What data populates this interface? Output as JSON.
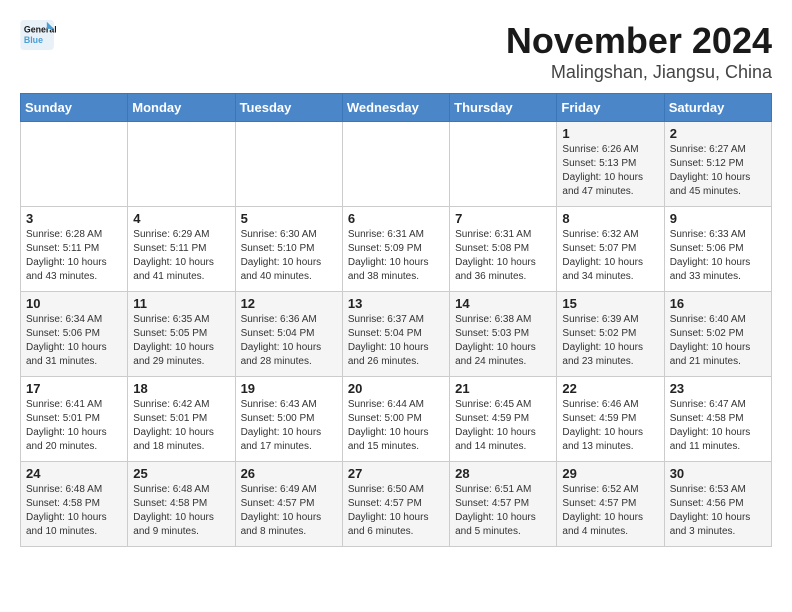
{
  "logo": {
    "text_general": "General",
    "text_blue": "Blue"
  },
  "title": "November 2024",
  "subtitle": "Malingshan, Jiangsu, China",
  "days_of_week": [
    "Sunday",
    "Monday",
    "Tuesday",
    "Wednesday",
    "Thursday",
    "Friday",
    "Saturday"
  ],
  "weeks": [
    [
      {
        "day": "",
        "info": ""
      },
      {
        "day": "",
        "info": ""
      },
      {
        "day": "",
        "info": ""
      },
      {
        "day": "",
        "info": ""
      },
      {
        "day": "",
        "info": ""
      },
      {
        "day": "1",
        "info": "Sunrise: 6:26 AM\nSunset: 5:13 PM\nDaylight: 10 hours\nand 47 minutes."
      },
      {
        "day": "2",
        "info": "Sunrise: 6:27 AM\nSunset: 5:12 PM\nDaylight: 10 hours\nand 45 minutes."
      }
    ],
    [
      {
        "day": "3",
        "info": "Sunrise: 6:28 AM\nSunset: 5:11 PM\nDaylight: 10 hours\nand 43 minutes."
      },
      {
        "day": "4",
        "info": "Sunrise: 6:29 AM\nSunset: 5:11 PM\nDaylight: 10 hours\nand 41 minutes."
      },
      {
        "day": "5",
        "info": "Sunrise: 6:30 AM\nSunset: 5:10 PM\nDaylight: 10 hours\nand 40 minutes."
      },
      {
        "day": "6",
        "info": "Sunrise: 6:31 AM\nSunset: 5:09 PM\nDaylight: 10 hours\nand 38 minutes."
      },
      {
        "day": "7",
        "info": "Sunrise: 6:31 AM\nSunset: 5:08 PM\nDaylight: 10 hours\nand 36 minutes."
      },
      {
        "day": "8",
        "info": "Sunrise: 6:32 AM\nSunset: 5:07 PM\nDaylight: 10 hours\nand 34 minutes."
      },
      {
        "day": "9",
        "info": "Sunrise: 6:33 AM\nSunset: 5:06 PM\nDaylight: 10 hours\nand 33 minutes."
      }
    ],
    [
      {
        "day": "10",
        "info": "Sunrise: 6:34 AM\nSunset: 5:06 PM\nDaylight: 10 hours\nand 31 minutes."
      },
      {
        "day": "11",
        "info": "Sunrise: 6:35 AM\nSunset: 5:05 PM\nDaylight: 10 hours\nand 29 minutes."
      },
      {
        "day": "12",
        "info": "Sunrise: 6:36 AM\nSunset: 5:04 PM\nDaylight: 10 hours\nand 28 minutes."
      },
      {
        "day": "13",
        "info": "Sunrise: 6:37 AM\nSunset: 5:04 PM\nDaylight: 10 hours\nand 26 minutes."
      },
      {
        "day": "14",
        "info": "Sunrise: 6:38 AM\nSunset: 5:03 PM\nDaylight: 10 hours\nand 24 minutes."
      },
      {
        "day": "15",
        "info": "Sunrise: 6:39 AM\nSunset: 5:02 PM\nDaylight: 10 hours\nand 23 minutes."
      },
      {
        "day": "16",
        "info": "Sunrise: 6:40 AM\nSunset: 5:02 PM\nDaylight: 10 hours\nand 21 minutes."
      }
    ],
    [
      {
        "day": "17",
        "info": "Sunrise: 6:41 AM\nSunset: 5:01 PM\nDaylight: 10 hours\nand 20 minutes."
      },
      {
        "day": "18",
        "info": "Sunrise: 6:42 AM\nSunset: 5:01 PM\nDaylight: 10 hours\nand 18 minutes."
      },
      {
        "day": "19",
        "info": "Sunrise: 6:43 AM\nSunset: 5:00 PM\nDaylight: 10 hours\nand 17 minutes."
      },
      {
        "day": "20",
        "info": "Sunrise: 6:44 AM\nSunset: 5:00 PM\nDaylight: 10 hours\nand 15 minutes."
      },
      {
        "day": "21",
        "info": "Sunrise: 6:45 AM\nSunset: 4:59 PM\nDaylight: 10 hours\nand 14 minutes."
      },
      {
        "day": "22",
        "info": "Sunrise: 6:46 AM\nSunset: 4:59 PM\nDaylight: 10 hours\nand 13 minutes."
      },
      {
        "day": "23",
        "info": "Sunrise: 6:47 AM\nSunset: 4:58 PM\nDaylight: 10 hours\nand 11 minutes."
      }
    ],
    [
      {
        "day": "24",
        "info": "Sunrise: 6:48 AM\nSunset: 4:58 PM\nDaylight: 10 hours\nand 10 minutes."
      },
      {
        "day": "25",
        "info": "Sunrise: 6:48 AM\nSunset: 4:58 PM\nDaylight: 10 hours\nand 9 minutes."
      },
      {
        "day": "26",
        "info": "Sunrise: 6:49 AM\nSunset: 4:57 PM\nDaylight: 10 hours\nand 8 minutes."
      },
      {
        "day": "27",
        "info": "Sunrise: 6:50 AM\nSunset: 4:57 PM\nDaylight: 10 hours\nand 6 minutes."
      },
      {
        "day": "28",
        "info": "Sunrise: 6:51 AM\nSunset: 4:57 PM\nDaylight: 10 hours\nand 5 minutes."
      },
      {
        "day": "29",
        "info": "Sunrise: 6:52 AM\nSunset: 4:57 PM\nDaylight: 10 hours\nand 4 minutes."
      },
      {
        "day": "30",
        "info": "Sunrise: 6:53 AM\nSunset: 4:56 PM\nDaylight: 10 hours\nand 3 minutes."
      }
    ]
  ]
}
